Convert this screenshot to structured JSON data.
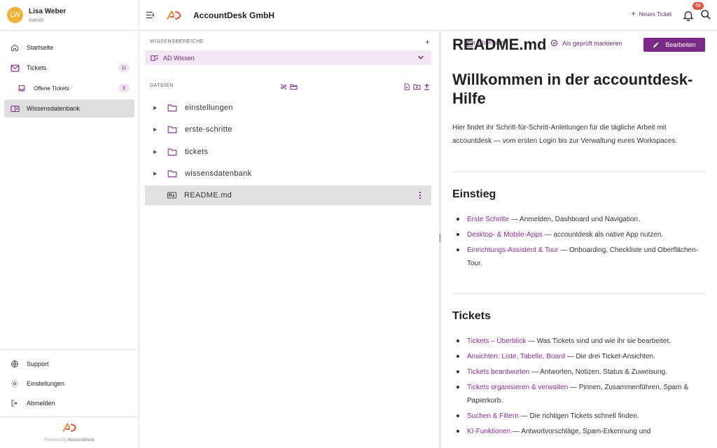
{
  "user": {
    "initials": "LW",
    "name": "Lisa Weber",
    "role": "owner"
  },
  "nav": {
    "items": [
      {
        "label": "Startseite",
        "icon": "home-icon"
      },
      {
        "label": "Tickets",
        "icon": "mail-icon",
        "badge": "11"
      },
      {
        "label": "Offene Tickets",
        "icon": "inbox-icon",
        "badge": "3"
      },
      {
        "label": "Wissensdatenbank",
        "icon": "book-icon",
        "active": true
      }
    ],
    "bottom": [
      {
        "label": "Support",
        "icon": "globe-icon"
      },
      {
        "label": "Einstellungen",
        "icon": "gear-icon"
      },
      {
        "label": "Abmelden",
        "icon": "logout-icon"
      }
    ],
    "powered_prefix": "Powered by",
    "powered_brand": "AccountDesk"
  },
  "topbar": {
    "company": "AccountDesk GmbH",
    "new_ticket": "Neues Ticket",
    "notification_count": "68"
  },
  "middle": {
    "kb_section_label": "WISSENSBEREICHE",
    "kb_selected": "AD Wissen",
    "files_section_label": "DATEIEN",
    "tree": [
      {
        "name": "einstellungen",
        "type": "folder"
      },
      {
        "name": "erste-schritte",
        "type": "folder"
      },
      {
        "name": "tickets",
        "type": "folder"
      },
      {
        "name": "wissensdatenbank",
        "type": "folder"
      },
      {
        "name": "README.md",
        "type": "markdown",
        "selected": true
      }
    ]
  },
  "doc": {
    "filename": "README.md",
    "back_label": "Zur Übersicht",
    "mark_reviewed": "Als geprüft markieren",
    "edit": "Bearbeiten",
    "heading": "Willkommen in der accountdesk-Hilfe",
    "intro": "Hier findet ihr Schritt-für-Schritt-Anleitungen für die tägliche Arbeit mit accountdesk — vom ersten Login bis zur Verwaltung eures Workspaces.",
    "sections": [
      {
        "title": "Einstieg",
        "items": [
          {
            "link": "Erste Schritte",
            "text": " — Anmelden, Dashboard und Navigation."
          },
          {
            "link": "Desktop- & Mobile-Apps",
            "text": " — accountdesk als native App nutzen."
          },
          {
            "link": "Einrichtungs-Assistent & Tour",
            "text": " — Onboarding, Checkliste und Oberflächen-Tour."
          }
        ]
      },
      {
        "title": "Tickets",
        "items": [
          {
            "link": "Tickets – Überblick",
            "text": " — Was Tickets sind und wie ihr sie bearbeitet."
          },
          {
            "link": "Ansichten: Liste, Tabelle, Board",
            "text": " — Die drei Ticket-Ansichten."
          },
          {
            "link": "Tickets beantworten",
            "text": " — Antworten, Notizen, Status & Zuweisung."
          },
          {
            "link": "Tickets organisieren & verwalten",
            "text": " — Pinnen, Zusammenführen, Spam & Papierkorb."
          },
          {
            "link": "Suchen & Filtern",
            "text": " — Die richtigen Tickets schnell finden."
          },
          {
            "link": "KI-Funktionen",
            "text": " — Antwortvorschläge, Spam-Erkennung und"
          }
        ]
      }
    ]
  },
  "colors": {
    "accent": "#7a2a86",
    "accent_light": "#f3e6f5",
    "avatar": "#f2b233",
    "notification": "#e05545",
    "brand_orange": "#f08a3c"
  }
}
